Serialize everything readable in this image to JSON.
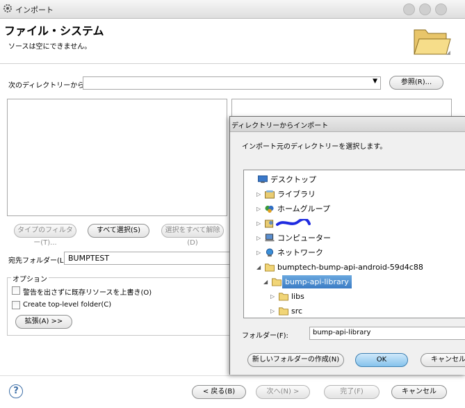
{
  "window": {
    "title": "インポート"
  },
  "header": {
    "title": "ファイル・システム",
    "message": "ソースは空にできません。"
  },
  "form": {
    "from_dir_label": "次のディレクトリーから(Y):",
    "from_dir_value": "",
    "browse_label": "参照(R)...",
    "filter_types_label": "タイプのフィルター(T)...",
    "select_all_label": "すべて選択(S)",
    "deselect_all_label": "選択をすべて解除(D)",
    "dest_folder_label": "宛先フォルダー(L):",
    "dest_folder_value": "BUMPTEST",
    "options_label": "オプション",
    "option_overwrite": "警告を出さずに既存リソースを上書き(O)",
    "option_toplevel": "Create top-level folder(C)",
    "advanced_label": "拡張(A) >>"
  },
  "footer": {
    "back_label": "< 戻る(B)",
    "next_label": "次へ(N) >",
    "finish_label": "完了(F)",
    "cancel_label": "キャンセル"
  },
  "dialog": {
    "title": "ディレクトリーからインポート",
    "prompt": "インポート元のディレクトリーを選択します。",
    "tree": [
      {
        "label": "デスクトップ",
        "icon": "desktop-icon",
        "expander": "none",
        "level": 0,
        "selected": false
      },
      {
        "label": "ライブラリ",
        "icon": "library-icon",
        "expander": "collapsed",
        "level": 1,
        "selected": false
      },
      {
        "label": "ホームグループ",
        "icon": "homegroup-icon",
        "expander": "collapsed",
        "level": 1,
        "selected": false
      },
      {
        "label": "",
        "icon": "user-folder-icon",
        "expander": "collapsed",
        "level": 1,
        "selected": false,
        "redacted": true
      },
      {
        "label": "コンピューター",
        "icon": "computer-icon",
        "expander": "collapsed",
        "level": 1,
        "selected": false
      },
      {
        "label": "ネットワーク",
        "icon": "network-icon",
        "expander": "collapsed",
        "level": 1,
        "selected": false
      },
      {
        "label": "bumptech-bump-api-android-59d4c88",
        "icon": "folder-icon",
        "expander": "expanded",
        "level": 1,
        "selected": false
      },
      {
        "label": "bump-api-library",
        "icon": "folder-icon",
        "expander": "expanded",
        "level": 2,
        "selected": true
      },
      {
        "label": "libs",
        "icon": "folder-icon",
        "expander": "collapsed",
        "level": 3,
        "selected": false
      },
      {
        "label": "src",
        "icon": "folder-icon",
        "expander": "collapsed",
        "level": 3,
        "selected": false
      }
    ],
    "folder_label": "フォルダー(F):",
    "folder_value": "bump-api-library",
    "new_folder_label": "新しいフォルダーの作成(N)",
    "ok_label": "OK",
    "cancel_label": "キャンセル"
  }
}
